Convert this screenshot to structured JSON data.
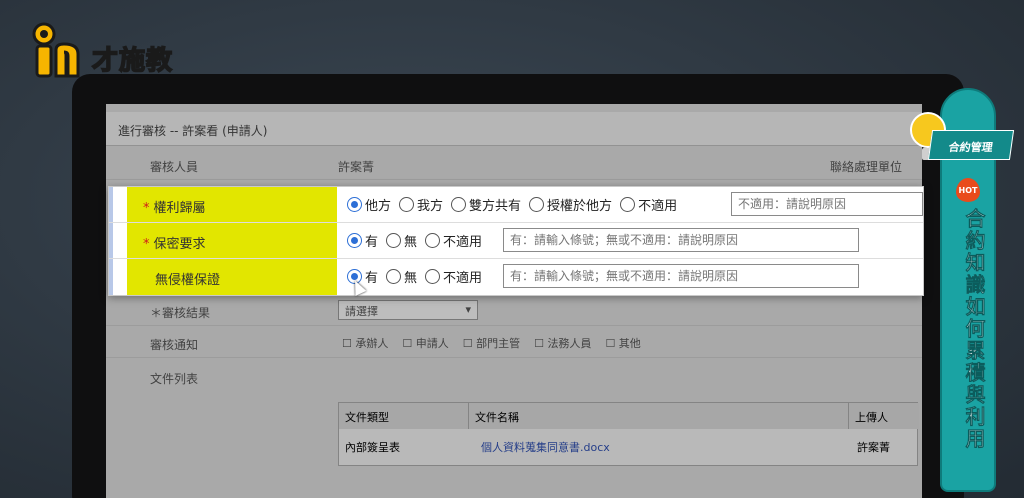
{
  "brand": {
    "logo_text": "才施教",
    "accent_color": "#f7b500"
  },
  "screen_background": {
    "header_title": "進行審核 -- 許案看 (申請人)",
    "rows": [
      {
        "label": "審核人員",
        "value": "許案菁",
        "right": "聯絡處理單位"
      },
      {
        "label": "＊審核結果",
        "value": "請選擇"
      },
      {
        "label": "審核通知",
        "checks": [
          "承辦人",
          "申請人",
          "部門主管",
          "法務人員",
          "其他"
        ]
      },
      {
        "label": "文件列表"
      }
    ],
    "doc_table": {
      "headers": [
        "文件類型",
        "文件名稱",
        "上傳人"
      ],
      "row": [
        "內部簽呈表",
        "個人資料蒐集同意書.docx",
        "許案菁"
      ]
    }
  },
  "panel": {
    "rows": [
      {
        "label": "權利歸屬",
        "required": true,
        "options": [
          "他方",
          "我方",
          "雙方共有",
          "授權於他方",
          "不適用"
        ],
        "selected_index": 0,
        "input_placeholder": "不適用：請說明原因"
      },
      {
        "label": "保密要求",
        "required": true,
        "options": [
          "有",
          "無",
          "不適用"
        ],
        "selected_index": 0,
        "input_placeholder": "有：請輸入條號；無或不適用：請說明原因"
      },
      {
        "label": "無侵權保證",
        "required": false,
        "options": [
          "有",
          "無",
          "不適用"
        ],
        "selected_index": 0,
        "input_placeholder": "有：請輸入條號；無或不適用：請說明原因"
      }
    ],
    "highlight_color": "#e2e600",
    "required_color": "#d01a1a",
    "radio_color": "#2d6fd6"
  },
  "banner": {
    "tag": "合約管理",
    "hot_badge": "HOT",
    "vertical_title": "合約知識如何累積與利用",
    "color": "#1aa3a3"
  },
  "icons": [
    "lightbulb-icon",
    "hot-flame-icon",
    "logo-keyhole-icon",
    "mouse-cursor-icon"
  ]
}
